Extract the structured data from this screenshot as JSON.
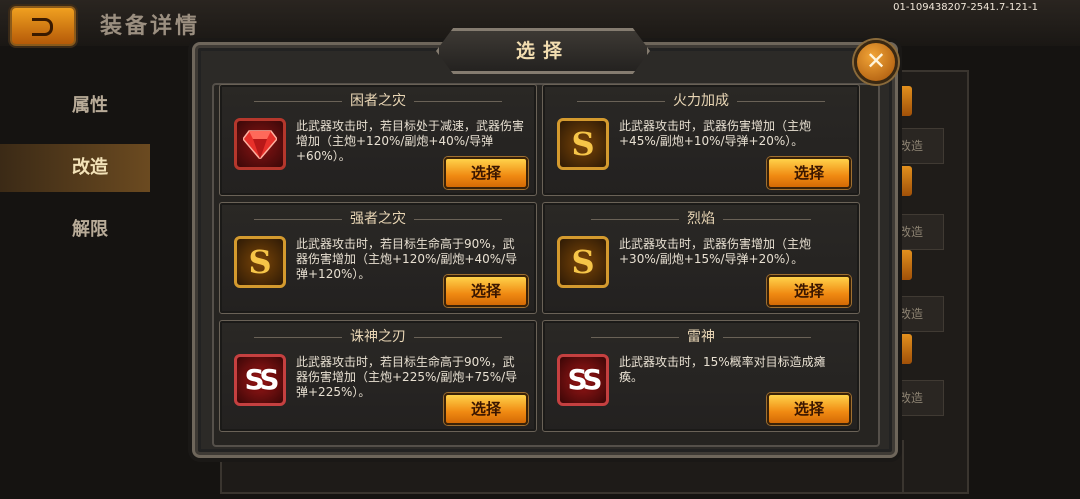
{
  "header": {
    "title": "装备详情",
    "build_id": "01-109438207-2541.7-121-1"
  },
  "sidebar": {
    "tabs": [
      {
        "label": "属性"
      },
      {
        "label": "改造"
      },
      {
        "label": "解限"
      }
    ]
  },
  "background_right": {
    "labels": [
      "改造",
      "改造",
      "改造",
      "改造"
    ]
  },
  "modal": {
    "title": "选择",
    "close_symbol": "✕",
    "cards": [
      {
        "title": "困者之灾",
        "icon": "red-gem-icon",
        "desc": "此武器攻击时，若目标处于减速，武器伤害增加（主炮+120%/副炮+40%/导弹+60%）。",
        "button": "选择"
      },
      {
        "title": "火力加成",
        "icon": "s-rank-icon",
        "icon_text": "S",
        "desc": "此武器攻击时，武器伤害增加（主炮+45%/副炮+10%/导弹+20%）。",
        "button": "选择"
      },
      {
        "title": "强者之灾",
        "icon": "s-rank-icon",
        "icon_text": "S",
        "desc": "此武器攻击时，若目标生命高于90%，武器伤害增加（主炮+120%/副炮+40%/导弹+120%）。",
        "button": "选择"
      },
      {
        "title": "烈焰",
        "icon": "s-rank-icon",
        "icon_text": "S",
        "desc": "此武器攻击时，武器伤害增加（主炮+30%/副炮+15%/导弹+20%）。",
        "button": "选择"
      },
      {
        "title": "诛神之刃",
        "icon": "ss-rank-icon",
        "icon_text": "SS",
        "desc": "此武器攻击时，若目标生命高于90%，武器伤害增加（主炮+225%/副炮+75%/导弹+225%）。",
        "button": "选择"
      },
      {
        "title": "雷神",
        "icon": "ss-rank-icon",
        "icon_text": "SS",
        "desc": "此武器攻击时，15%概率对目标造成瘫痪。",
        "button": "选择"
      }
    ]
  }
}
